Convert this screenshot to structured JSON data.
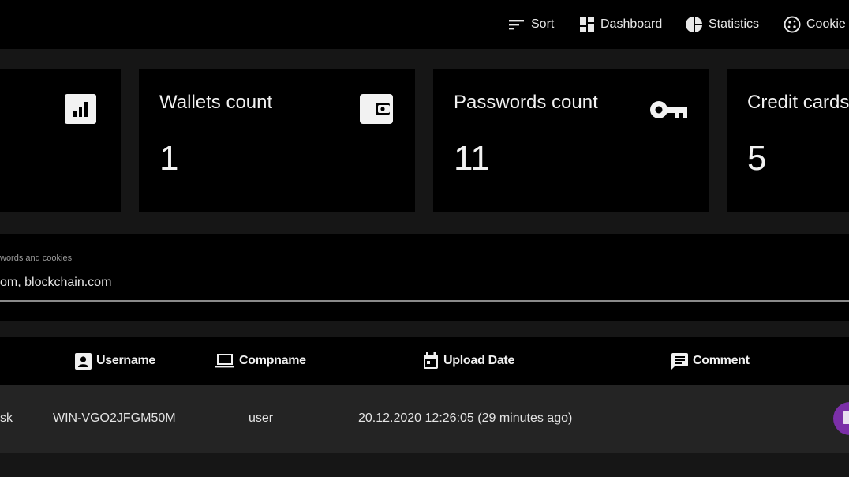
{
  "nav": {
    "sort": "Sort",
    "dashboard": "Dashboard",
    "statistics": "Statistics",
    "cookie": "Cookie c"
  },
  "cards": {
    "first_icon": "bar-chart-icon",
    "wallets": {
      "title": "Wallets count",
      "value": "1",
      "icon": "wallet-icon"
    },
    "passwords": {
      "title": "Passwords count",
      "value": "11",
      "icon": "key-icon"
    },
    "credit_cards": {
      "title": "Credit cards",
      "value": "5"
    }
  },
  "search": {
    "label": "words and cookies",
    "value": "om, blockchain.com"
  },
  "table": {
    "headers": [
      "Username",
      "Compname",
      "Upload Date",
      "Comment"
    ],
    "rows": [
      {
        "col0": "sk",
        "username": "WIN-VGO2JFGM50M",
        "compname": "user",
        "upload_date": "20.12.2020 12:26:05 (29 minutes ago)",
        "comment": ""
      }
    ]
  },
  "colors": {
    "accent": "#7b2fa8",
    "card_bg": "#000000",
    "page_bg": "#161616",
    "row_bg": "#242424"
  }
}
